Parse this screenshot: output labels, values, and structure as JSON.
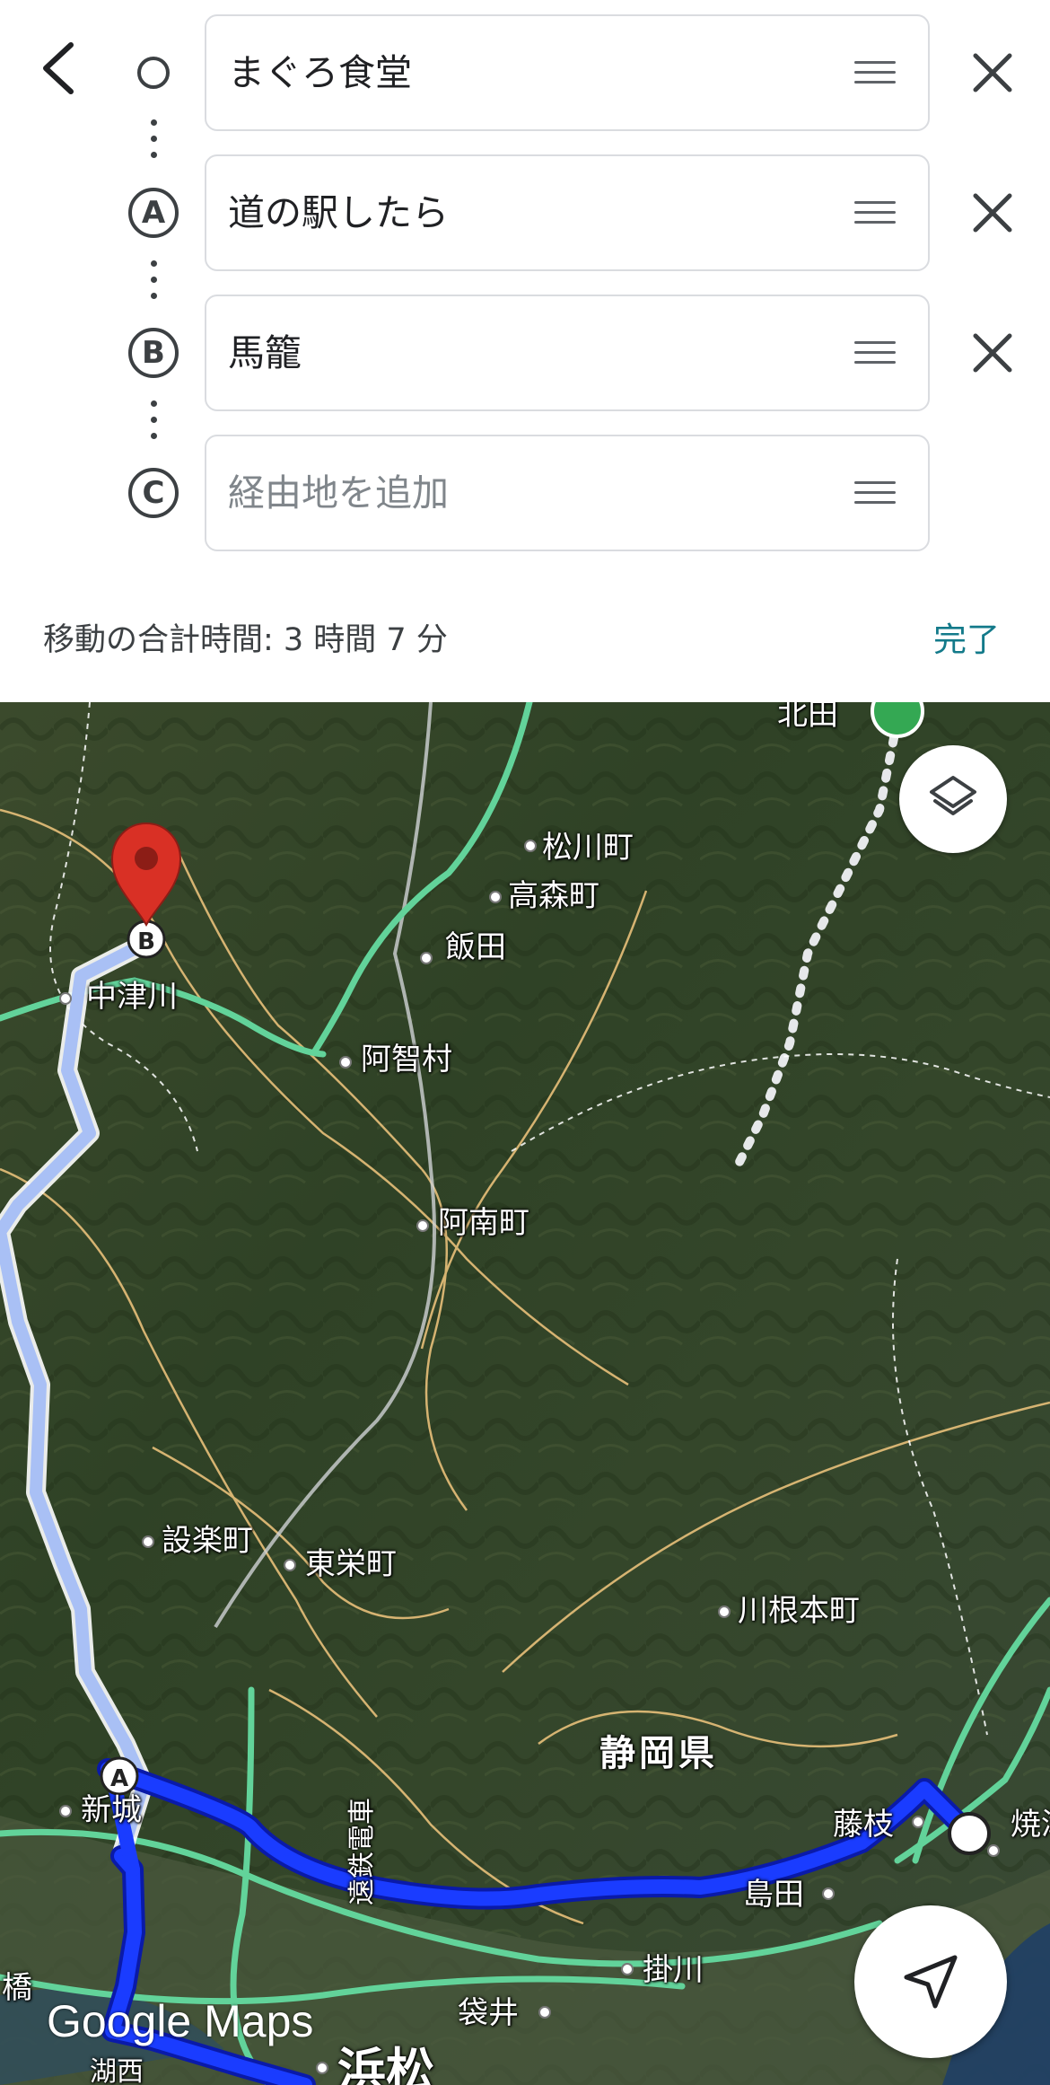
{
  "route_panel": {
    "stops": [
      {
        "marker": "",
        "value": "まぐろ食堂",
        "placeholder": ""
      },
      {
        "marker": "A",
        "value": "道の駅したら",
        "placeholder": ""
      },
      {
        "marker": "B",
        "value": "馬籠",
        "placeholder": ""
      },
      {
        "marker": "C",
        "value": "",
        "placeholder": "経由地を追加"
      }
    ],
    "total_time": "移動の合計時間: 3 時間 7 分",
    "done_label": "完了"
  },
  "map": {
    "labels": [
      {
        "text": "松川町"
      },
      {
        "text": "高森町"
      },
      {
        "text": "飯田"
      },
      {
        "text": "中津川"
      },
      {
        "text": "阿智村"
      },
      {
        "text": "阿南町"
      },
      {
        "text": "設楽町"
      },
      {
        "text": "東栄町"
      },
      {
        "text": "川根本町"
      },
      {
        "text": "静岡県"
      },
      {
        "text": "新城"
      },
      {
        "text": "藤枝"
      },
      {
        "text": "島田"
      },
      {
        "text": "焼津"
      },
      {
        "text": "掛川"
      },
      {
        "text": "袋井"
      },
      {
        "text": "浜松"
      },
      {
        "text": "遠鉄電車"
      },
      {
        "text": "湖西"
      },
      {
        "text": "橋"
      },
      {
        "text": "北田"
      }
    ],
    "markers": {
      "a": "A",
      "b": "B"
    },
    "attribution": "Google Maps"
  },
  "colors": {
    "route_active": "#1a3cff",
    "route_alt": "#a9c0f5",
    "highway": "#62d39a",
    "road": "#e8c07a",
    "pin": "#d93025"
  }
}
